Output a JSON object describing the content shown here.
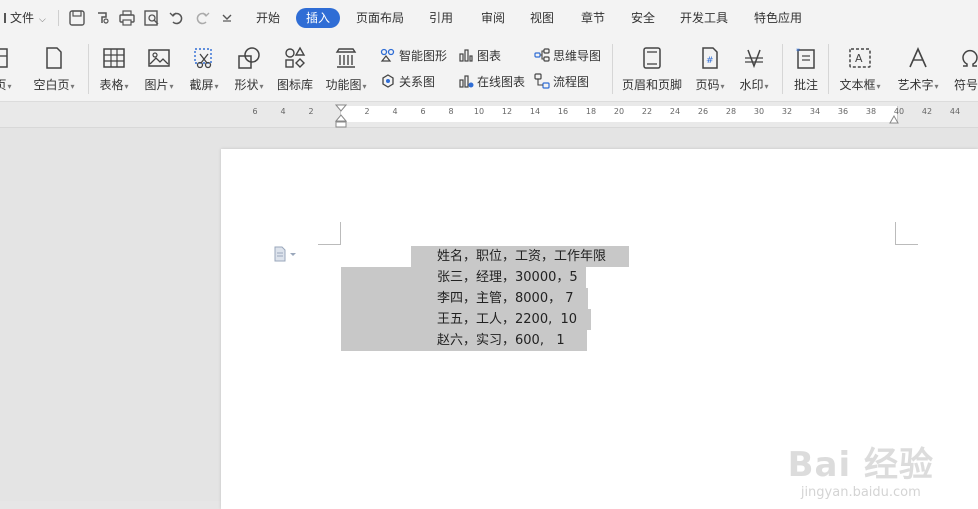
{
  "menubar": {
    "file_label": "文件",
    "tabs": [
      {
        "label": "开始"
      },
      {
        "label": "插入",
        "active": true
      },
      {
        "label": "页面布局"
      },
      {
        "label": "引用"
      },
      {
        "label": "审阅"
      },
      {
        "label": "视图"
      },
      {
        "label": "章节"
      },
      {
        "label": "安全"
      },
      {
        "label": "开发工具"
      },
      {
        "label": "特色应用"
      }
    ]
  },
  "ribbon": {
    "page_partial": "页",
    "blank_page": "空白页",
    "table": "表格",
    "picture": "图片",
    "screenshot": "截屏",
    "shape": "形状",
    "icon_lib": "图标库",
    "function_chart": "功能图",
    "smart_art": "智能图形",
    "relation_chart": "关系图",
    "chart": "图表",
    "online_chart": "在线图表",
    "mind_map": "思维导图",
    "flowchart": "流程图",
    "header_footer": "页眉和页脚",
    "page_number": "页码",
    "watermark": "水印",
    "comment": "批注",
    "text_box": "文本框",
    "word_art": "艺术字",
    "symbol_partial": "符号"
  },
  "ruler": {
    "ticks": [
      "6",
      "4",
      "2",
      "",
      "2",
      "4",
      "6",
      "8",
      "10",
      "12",
      "14",
      "16",
      "18",
      "20",
      "22",
      "24",
      "26",
      "28",
      "30",
      "32",
      "34",
      "36",
      "38",
      "40",
      "42",
      "44"
    ]
  },
  "document": {
    "lines": [
      "姓名，职位，工资，工作年限",
      "张三，经理，30000，5",
      "李四，主管，8000， 7",
      "王五，工人，2200,  10",
      "赵六，实习，600,   1"
    ]
  },
  "watermark": {
    "brand": "Bai 经验",
    "url": "jingyan.baidu.com"
  },
  "colors": {
    "accent": "#2f6dd5",
    "selection": "#c8c8c8"
  }
}
